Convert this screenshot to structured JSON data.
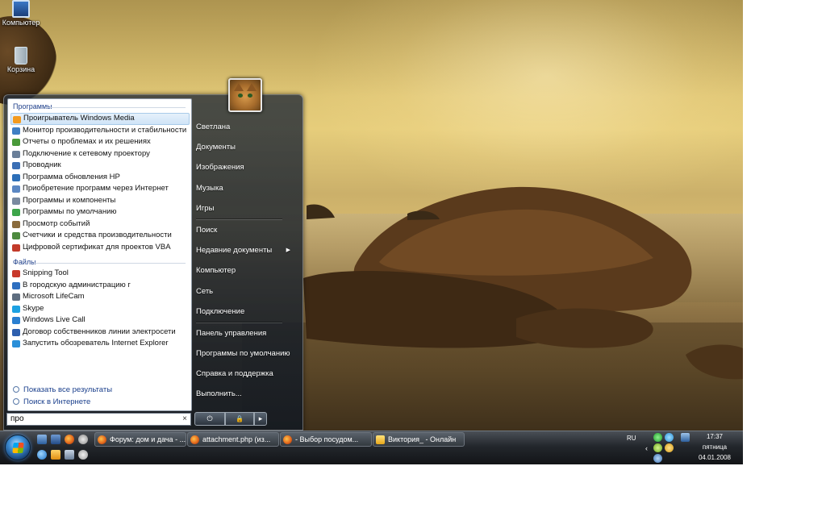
{
  "desktop": {
    "icons": [
      {
        "label": "Компьютер",
        "icon": "computer-icon"
      },
      {
        "label": "Корзина",
        "icon": "recycle-bin-icon"
      }
    ]
  },
  "start_menu": {
    "programs_header": "Программы",
    "programs": [
      {
        "label": "Проигрыватель Windows Media",
        "color": "#f39a1e",
        "selected": true
      },
      {
        "label": "Монитор производительности и стабильности",
        "color": "#3f7fc4"
      },
      {
        "label": "Отчеты о проблемах и их решениях",
        "color": "#4a9a3a"
      },
      {
        "label": "Подключение к сетевому проектору",
        "color": "#6a7f99"
      },
      {
        "label": "Проводник",
        "color": "#3b6fb5"
      },
      {
        "label": "Программа обновления HP",
        "color": "#2d6fb8"
      },
      {
        "label": "Приобретение программ через Интернет",
        "color": "#5b87c3"
      },
      {
        "label": "Программы и компоненты",
        "color": "#7a8aa0"
      },
      {
        "label": "Программы по умолчанию",
        "color": "#3da54a"
      },
      {
        "label": "Просмотр событий",
        "color": "#8a6b3c"
      },
      {
        "label": "Счетчики и средства производительности",
        "color": "#4d8a3f"
      },
      {
        "label": "Цифровой сертификат для проектов VBA",
        "color": "#c23a2a"
      }
    ],
    "files_header": "Файлы",
    "files": [
      {
        "label": "Snipping Tool",
        "color": "#c8382b"
      },
      {
        "label": "В городскую администрацию г",
        "color": "#2e6fc0"
      },
      {
        "label": "Microsoft LifeCam",
        "color": "#5e6e80"
      },
      {
        "label": "Skype",
        "color": "#1da1e2"
      },
      {
        "label": "Windows Live Call",
        "color": "#2a7fd1"
      },
      {
        "label": "Договор собственников линии электросети",
        "color": "#2e5fae"
      },
      {
        "label": "Запустить обозреватель Internet Explorer",
        "color": "#2a8fd8"
      }
    ],
    "show_all_results": "Показать все результаты",
    "search_internet": "Поиск в Интернете",
    "search_value": "про",
    "search_clear": "×",
    "right_pane": [
      {
        "label": "Светлана"
      },
      {
        "label": "Документы"
      },
      {
        "label": "Изображения"
      },
      {
        "label": "Музыка"
      },
      {
        "label": "Игры"
      },
      {
        "separator": true
      },
      {
        "label": "Поиск"
      },
      {
        "label": "Недавние документы",
        "has_arrow": true
      },
      {
        "label": "Компьютер"
      },
      {
        "label": "Сеть"
      },
      {
        "label": "Подключение"
      },
      {
        "separator": true
      },
      {
        "label": "Панель управления"
      },
      {
        "label": "Программы по умолчанию"
      },
      {
        "label": "Справка и поддержка"
      },
      {
        "label": "Выполнить..."
      }
    ],
    "power_symbol": "⏻",
    "lock_symbol": "🔒",
    "power_arrow": "▸"
  },
  "taskbar": {
    "buttons": [
      {
        "label": "Форум: дом и дача - ..."
      },
      {
        "label": "attachment.php (из..."
      },
      {
        "label": "- Выбор посудом..."
      },
      {
        "label": "Виктория_ - Онлайн"
      }
    ],
    "language": "RU",
    "tray_chevron": "‹",
    "clock": {
      "time": "17:37",
      "day": "пятница",
      "date": "04.01.2008"
    }
  }
}
